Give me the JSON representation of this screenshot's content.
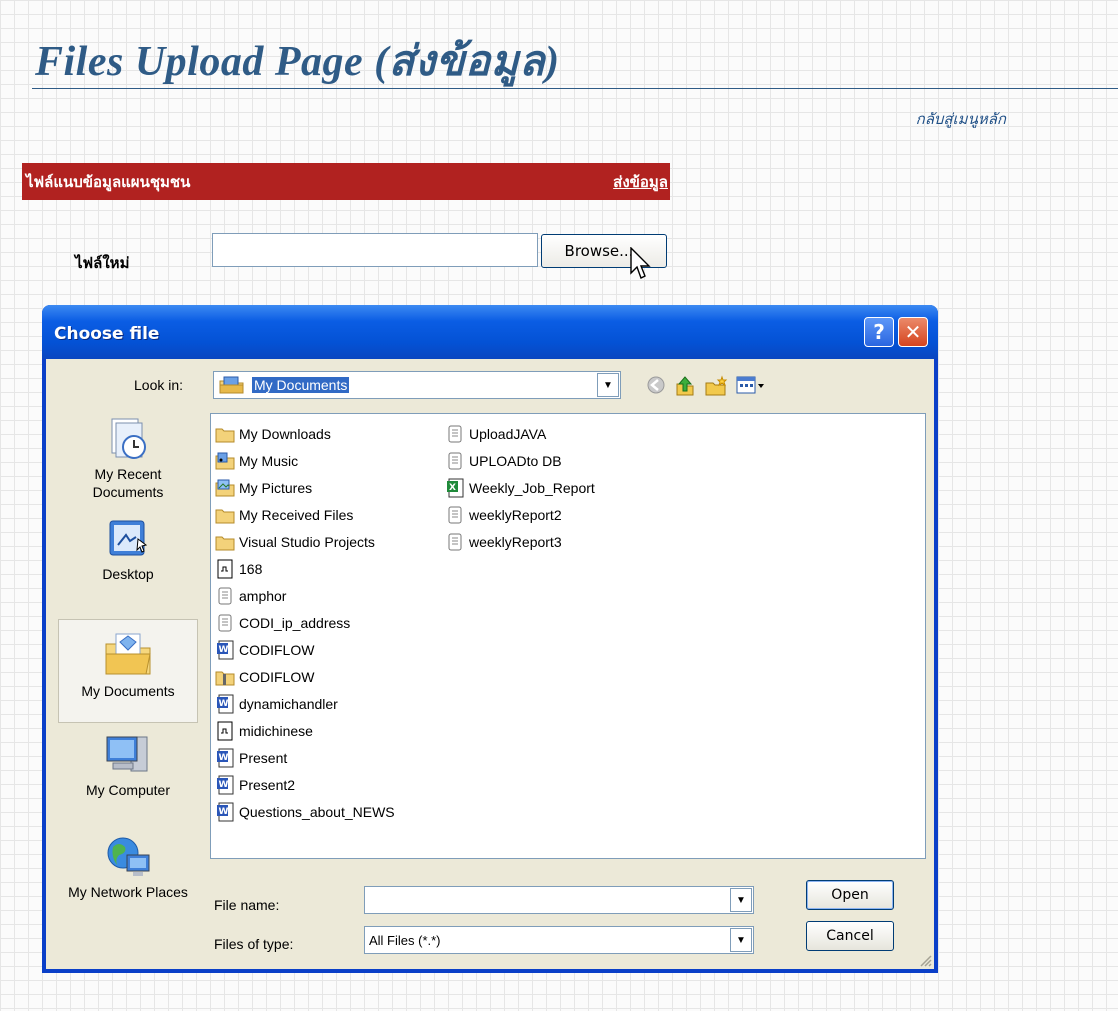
{
  "page": {
    "title": "Files Upload Page (ส่งข้อมูล)",
    "home_link": "กลับสู่เมนูหลัก",
    "upload_bar": {
      "label": "ไฟล์แนบข้อมูลแผนชุมชน",
      "send_link": "ส่งข้อมูล"
    },
    "new_file_label": "ไฟล์ใหม่",
    "file_input_value": "",
    "browse_label": "Browse..."
  },
  "dialog": {
    "title": "Choose file",
    "help_label": "?",
    "close_label": "✕",
    "look_in_label": "Look in:",
    "look_in_value": "My Documents",
    "places": [
      {
        "label": "My Recent Documents",
        "icon": "recent-documents-icon"
      },
      {
        "label": "Desktop",
        "icon": "desktop-icon"
      },
      {
        "label": "My Documents",
        "icon": "my-documents-icon",
        "selected": true
      },
      {
        "label": "My Computer",
        "icon": "my-computer-icon"
      },
      {
        "label": "My Network Places",
        "icon": "network-places-icon"
      }
    ],
    "files_col1": [
      {
        "name": "My Downloads",
        "icon": "folder"
      },
      {
        "name": "My Music",
        "icon": "music-folder"
      },
      {
        "name": "My Pictures",
        "icon": "pictures-folder"
      },
      {
        "name": "My Received Files",
        "icon": "folder"
      },
      {
        "name": "Visual Studio Projects",
        "icon": "folder"
      },
      {
        "name": "168",
        "icon": "generic-file"
      },
      {
        "name": "amphor",
        "icon": "text-file"
      },
      {
        "name": "CODI_ip_address",
        "icon": "text-file"
      },
      {
        "name": "CODIFLOW",
        "icon": "word-doc"
      },
      {
        "name": "CODIFLOW",
        "icon": "zip-file"
      },
      {
        "name": "dynamichandler",
        "icon": "word-doc"
      },
      {
        "name": "midichinese",
        "icon": "generic-file"
      },
      {
        "name": "Present",
        "icon": "word-doc"
      },
      {
        "name": "Present2",
        "icon": "word-doc"
      },
      {
        "name": "Questions_about_NEWS",
        "icon": "word-doc"
      }
    ],
    "files_col2": [
      {
        "name": "UploadJAVA",
        "icon": "text-file"
      },
      {
        "name": "UPLOADto DB",
        "icon": "text-file"
      },
      {
        "name": "Weekly_Job_Report",
        "icon": "excel-file"
      },
      {
        "name": "weeklyReport2",
        "icon": "text-file"
      },
      {
        "name": "weeklyReport3",
        "icon": "text-file"
      }
    ],
    "file_name_label": "File name:",
    "file_name_value": "",
    "files_of_type_label": "Files of type:",
    "files_of_type_value": "All Files (*.*)",
    "open_label": "Open",
    "cancel_label": "Cancel"
  },
  "colors": {
    "title_blue": "#2f5b86",
    "bar_red": "#b12220",
    "xp_blue": "#0a46c0",
    "selection": "#316ac5"
  }
}
